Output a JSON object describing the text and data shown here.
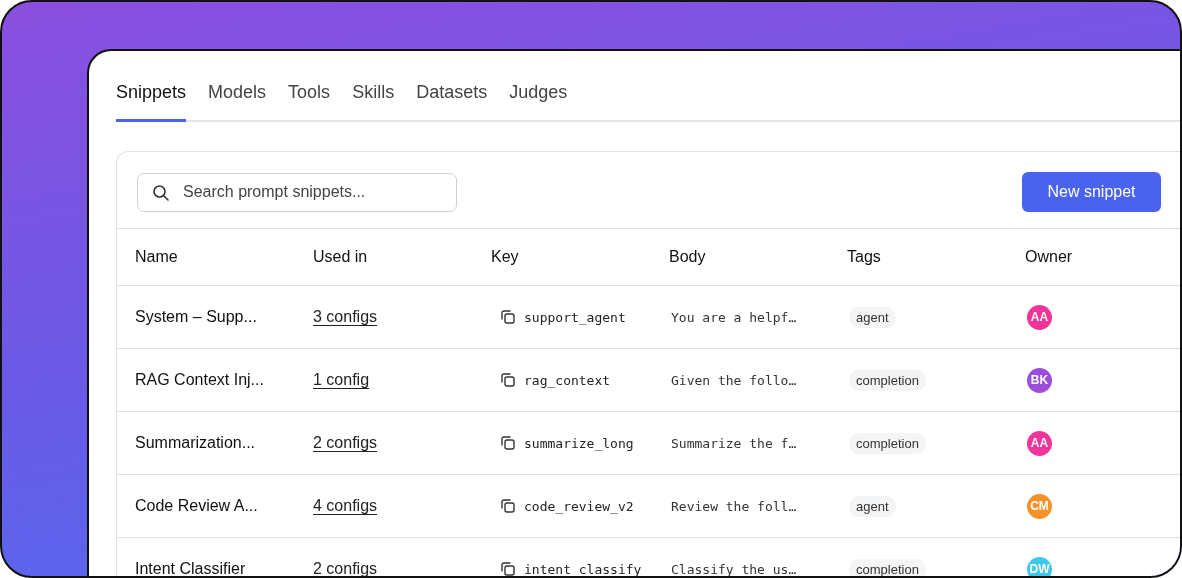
{
  "tabs": [
    {
      "label": "Snippets",
      "selected": true
    },
    {
      "label": "Models",
      "selected": false
    },
    {
      "label": "Tools",
      "selected": false
    },
    {
      "label": "Skills",
      "selected": false
    },
    {
      "label": "Datasets",
      "selected": false
    },
    {
      "label": "Judges",
      "selected": false
    }
  ],
  "search": {
    "placeholder": "Search prompt snippets..."
  },
  "new_button": "New snippet",
  "table": {
    "columns": [
      "Name",
      "Used in",
      "Key",
      "Body",
      "Tags",
      "Owner"
    ],
    "rows": [
      {
        "name": "System – Supp...",
        "used_in": "3 configs",
        "key": "support_agent",
        "body": "You are a helpf…",
        "tag": "agent",
        "owner": "AA",
        "color": "#f0349a"
      },
      {
        "name": "RAG Context Inj...",
        "used_in": "1 config",
        "key": "rag_context",
        "body": "Given the follo…",
        "tag": "completion",
        "owner": "BK",
        "color": "#9b4ddb"
      },
      {
        "name": "Summarization...",
        "used_in": "2 configs",
        "key": "summarize_long",
        "body": "Summarize the f…",
        "tag": "completion",
        "owner": "AA",
        "color": "#f0349a"
      },
      {
        "name": "Code Review A...",
        "used_in": "4 configs",
        "key": "code_review_v2",
        "body": "Review the foll…",
        "tag": "agent",
        "owner": "CM",
        "color": "#f7922a"
      },
      {
        "name": "Intent Classifier",
        "used_in": "2 configs",
        "key": "intent_classify",
        "body": "Classify the us…",
        "tag": "completion",
        "owner": "DW",
        "color": "#3fc8ef"
      }
    ]
  }
}
